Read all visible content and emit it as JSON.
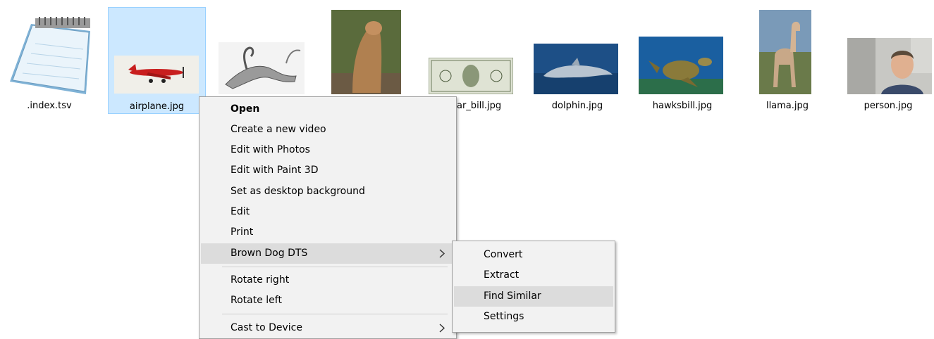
{
  "files": [
    {
      "name": ".index.tsv",
      "icon": "notepad-icon"
    },
    {
      "name": "airplane.jpg",
      "icon": "airplane-photo",
      "selected": true
    },
    {
      "name": "",
      "icon": "dinosaur-sketch"
    },
    {
      "name": "",
      "icon": "cougar-photo"
    },
    {
      "name": "ar_bill.jpg",
      "icon": "dollar-bill-photo"
    },
    {
      "name": "dolphin.jpg",
      "icon": "dolphin-photo"
    },
    {
      "name": "hawksbill.jpg",
      "icon": "turtle-photo"
    },
    {
      "name": "llama.jpg",
      "icon": "llama-photo"
    },
    {
      "name": "person.jpg",
      "icon": "person-photo"
    }
  ],
  "context_menu": {
    "items": [
      {
        "label": "Open",
        "bold": true
      },
      {
        "label": "Create a new video"
      },
      {
        "label": "Edit with Photos"
      },
      {
        "label": "Edit with Paint 3D"
      },
      {
        "label": "Set as desktop background"
      },
      {
        "label": "Edit"
      },
      {
        "label": "Print"
      },
      {
        "label": "Brown Dog DTS",
        "submenu": true,
        "highlighted": true
      },
      {
        "label": "Rotate right"
      },
      {
        "label": "Rotate left"
      },
      {
        "label": "Cast to Device",
        "submenu": true
      }
    ]
  },
  "submenu": {
    "items": [
      {
        "label": "Convert"
      },
      {
        "label": "Extract"
      },
      {
        "label": "Find Similar",
        "highlighted": true
      },
      {
        "label": "Settings"
      }
    ]
  },
  "colors": {
    "selection_bg": "#cce8ff",
    "selection_border": "#99d1ff",
    "menu_bg": "#f2f2f2",
    "menu_highlight": "#dcdcdc"
  }
}
